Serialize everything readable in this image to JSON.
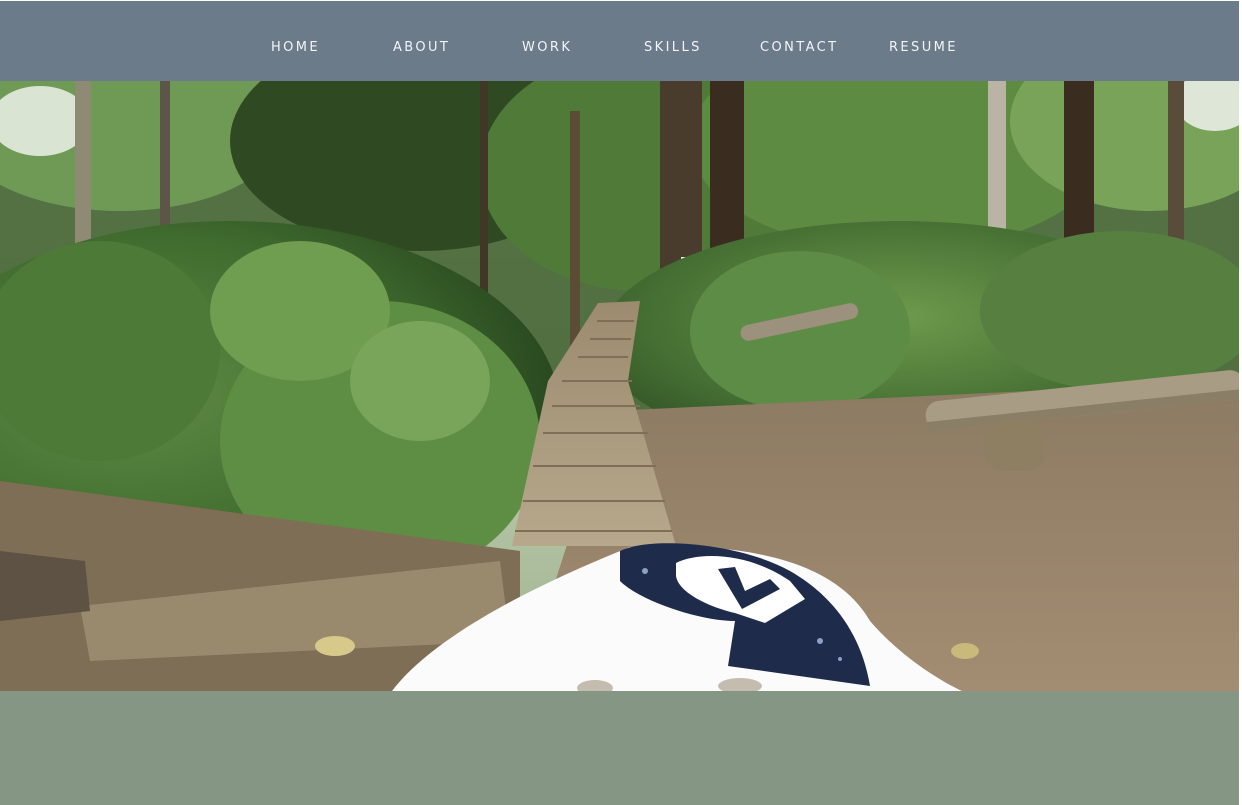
{
  "nav": {
    "items": [
      {
        "label": "HOME"
      },
      {
        "label": "ABOUT"
      },
      {
        "label": "WORK"
      },
      {
        "label": "SKILLS"
      },
      {
        "label": "CONTACT"
      },
      {
        "label": "RESUME"
      }
    ]
  },
  "colors": {
    "nav_background": "#6c7b8a",
    "nav_text": "#f2f4f6",
    "footer_band": "#859684"
  }
}
